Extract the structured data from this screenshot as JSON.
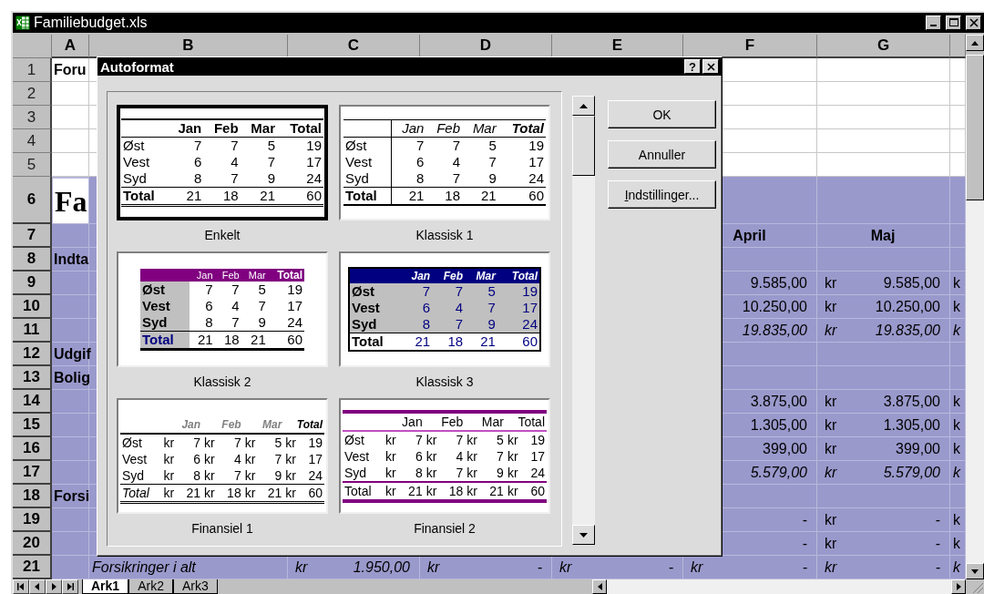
{
  "window": {
    "title": "Familiebudget.xls"
  },
  "columns": [
    "A",
    "B",
    "C",
    "D",
    "E",
    "F",
    "G"
  ],
  "rows": [
    {
      "number": "1",
      "selected": false,
      "cells": [
        {
          "kind": "heading",
          "text": "Foru"
        }
      ]
    },
    {
      "number": "2",
      "selected": false
    },
    {
      "number": "3",
      "selected": false
    },
    {
      "number": "4",
      "selected": false
    },
    {
      "number": "5",
      "selected": false
    },
    {
      "number": "6",
      "selected": true,
      "cells": [
        {
          "kind": "title",
          "text": "Fa"
        }
      ]
    },
    {
      "number": "7",
      "selected": true,
      "cells": [
        null,
        null,
        null,
        null,
        null,
        {
          "kind": "heading-center",
          "text": "April"
        },
        {
          "kind": "heading-center",
          "text": "Maj"
        }
      ]
    },
    {
      "number": "8",
      "selected": true,
      "cells": [
        {
          "kind": "heading",
          "text": "Indta"
        }
      ]
    },
    {
      "number": "9",
      "selected": true,
      "cells": [
        null,
        null,
        null,
        null,
        null,
        {
          "kind": "amount",
          "text": "9.585,00"
        },
        {
          "kind": "accounting",
          "currency": "kr",
          "amount": "9.585,00"
        },
        {
          "kind": "text",
          "text": "k"
        }
      ]
    },
    {
      "number": "10",
      "selected": true,
      "cells": [
        null,
        null,
        null,
        null,
        null,
        {
          "kind": "amount",
          "text": "10.250,00"
        },
        {
          "kind": "accounting",
          "currency": "kr",
          "amount": "10.250,00"
        },
        {
          "kind": "text",
          "text": "k"
        }
      ]
    },
    {
      "number": "11",
      "selected": true,
      "cells": [
        null,
        null,
        null,
        null,
        null,
        {
          "kind": "amount",
          "text": "19.835,00",
          "italic": true
        },
        {
          "kind": "accounting",
          "currency": "kr",
          "amount": "19.835,00",
          "italic": true
        },
        {
          "kind": "text",
          "text": "k",
          "italic": true
        }
      ]
    },
    {
      "number": "12",
      "selected": true,
      "cells": [
        {
          "kind": "heading",
          "text": "Udgif"
        }
      ]
    },
    {
      "number": "13",
      "selected": true,
      "cells": [
        {
          "kind": "heading",
          "text": "Bolig"
        }
      ]
    },
    {
      "number": "14",
      "selected": true,
      "cells": [
        null,
        null,
        null,
        null,
        null,
        {
          "kind": "amount",
          "text": "3.875,00"
        },
        {
          "kind": "accounting",
          "currency": "kr",
          "amount": "3.875,00"
        },
        {
          "kind": "text",
          "text": "k"
        }
      ]
    },
    {
      "number": "15",
      "selected": true,
      "cells": [
        null,
        null,
        null,
        null,
        null,
        {
          "kind": "amount",
          "text": "1.305,00"
        },
        {
          "kind": "accounting",
          "currency": "kr",
          "amount": "1.305,00"
        },
        {
          "kind": "text",
          "text": "k"
        }
      ]
    },
    {
      "number": "16",
      "selected": true,
      "cells": [
        null,
        null,
        null,
        null,
        null,
        {
          "kind": "amount",
          "text": "399,00"
        },
        {
          "kind": "accounting",
          "currency": "kr",
          "amount": "399,00"
        },
        {
          "kind": "text",
          "text": "k"
        }
      ]
    },
    {
      "number": "17",
      "selected": true,
      "cells": [
        null,
        null,
        null,
        null,
        null,
        {
          "kind": "amount",
          "text": "5.579,00",
          "italic": true
        },
        {
          "kind": "accounting",
          "currency": "kr",
          "amount": "5.579,00",
          "italic": true
        },
        {
          "kind": "text",
          "text": "k",
          "italic": true
        }
      ]
    },
    {
      "number": "18",
      "selected": true,
      "cells": [
        {
          "kind": "heading",
          "text": "Forsi"
        }
      ]
    },
    {
      "number": "19",
      "selected": true,
      "cells": [
        null,
        null,
        null,
        null,
        null,
        {
          "kind": "amount",
          "text": "-"
        },
        {
          "kind": "accounting",
          "currency": "kr",
          "amount": "-"
        },
        {
          "kind": "text",
          "text": "k"
        }
      ]
    },
    {
      "number": "20",
      "selected": true,
      "cells": [
        null,
        null,
        null,
        null,
        null,
        {
          "kind": "amount",
          "text": "-"
        },
        {
          "kind": "accounting",
          "currency": "kr",
          "amount": "-"
        },
        {
          "kind": "text",
          "text": "k"
        }
      ]
    },
    {
      "number": "21",
      "selected": true,
      "cells": [
        null,
        {
          "kind": "text",
          "text": "Forsikringer i alt",
          "italic": true
        },
        {
          "kind": "accounting",
          "currency": "kr",
          "amount": "1.950,00",
          "italic": true
        },
        {
          "kind": "accounting",
          "currency": "kr",
          "amount": "-",
          "italic": true
        },
        {
          "kind": "accounting",
          "currency": "kr",
          "amount": "-",
          "italic": true
        },
        {
          "kind": "accounting",
          "currency": "kr",
          "amount": "-",
          "italic": true
        },
        {
          "kind": "accounting",
          "currency": "kr",
          "amount": "-",
          "italic": true
        },
        {
          "kind": "text",
          "text": "k",
          "italic": true
        }
      ]
    }
  ],
  "sheet_tabs": [
    {
      "label": "Ark1",
      "selected": true
    },
    {
      "label": "Ark2",
      "selected": false
    },
    {
      "label": "Ark3",
      "selected": false
    }
  ],
  "dialog": {
    "title": "Autoformat",
    "help": "?",
    "formats": [
      {
        "name": "Enkelt",
        "kind": "enkelt",
        "selected": true,
        "header": [
          "Jan",
          "Feb",
          "Mar",
          "Total"
        ],
        "rows": [
          [
            "Øst",
            "7",
            "7",
            "5",
            "19"
          ],
          [
            "Vest",
            "6",
            "4",
            "7",
            "17"
          ],
          [
            "Syd",
            "8",
            "7",
            "9",
            "24"
          ]
        ],
        "total": [
          "Total",
          "21",
          "18",
          "21",
          "60"
        ]
      },
      {
        "name": "Klassisk 1",
        "kind": "klassisk1",
        "selected": false,
        "header": [
          "Jan",
          "Feb",
          "Mar",
          "Total"
        ],
        "rows": [
          [
            "Øst",
            "7",
            "7",
            "5",
            "19"
          ],
          [
            "Vest",
            "6",
            "4",
            "7",
            "17"
          ],
          [
            "Syd",
            "8",
            "7",
            "9",
            "24"
          ]
        ],
        "total": [
          "Total",
          "21",
          "18",
          "21",
          "60"
        ]
      },
      {
        "name": "Klassisk 2",
        "kind": "klassisk2",
        "selected": false,
        "header": [
          "Jan",
          "Feb",
          "Mar",
          "Total"
        ],
        "rows": [
          [
            "Øst",
            "7",
            "7",
            "5",
            "19"
          ],
          [
            "Vest",
            "6",
            "4",
            "7",
            "17"
          ],
          [
            "Syd",
            "8",
            "7",
            "9",
            "24"
          ]
        ],
        "total": [
          "Total",
          "21",
          "18",
          "21",
          "60"
        ]
      },
      {
        "name": "Klassisk 3",
        "kind": "klassisk3",
        "selected": false,
        "header": [
          "Jan",
          "Feb",
          "Mar",
          "Total"
        ],
        "rows": [
          [
            "Øst",
            "7",
            "7",
            "5",
            "19"
          ],
          [
            "Vest",
            "6",
            "4",
            "7",
            "17"
          ],
          [
            "Syd",
            "8",
            "7",
            "9",
            "24"
          ]
        ],
        "total": [
          "Total",
          "21",
          "18",
          "21",
          "60"
        ]
      },
      {
        "name": "Finansiel 1",
        "kind": "finansiel1",
        "selected": false,
        "header": [
          "Jan",
          "Feb",
          "Mar",
          "Total"
        ],
        "rows": [
          [
            "Øst",
            "kr",
            "7",
            "kr",
            "7",
            "kr",
            "5",
            "kr",
            "19"
          ],
          [
            "Vest",
            "kr",
            "6",
            "kr",
            "4",
            "kr",
            "7",
            "kr",
            "17"
          ],
          [
            "Syd",
            "kr",
            "8",
            "kr",
            "7",
            "kr",
            "9",
            "kr",
            "24"
          ]
        ],
        "total": [
          "Total",
          "kr",
          "21",
          "kr",
          "18",
          "kr",
          "21",
          "kr",
          "60"
        ]
      },
      {
        "name": "Finansiel 2",
        "kind": "finansiel2",
        "selected": false,
        "header": [
          "Jan",
          "Feb",
          "Mar",
          "Total"
        ],
        "rows": [
          [
            "Øst",
            "kr",
            "7",
            "kr",
            "7",
            "kr",
            "5",
            "kr",
            "19"
          ],
          [
            "Vest",
            "kr",
            "6",
            "kr",
            "4",
            "kr",
            "7",
            "kr",
            "17"
          ],
          [
            "Syd",
            "kr",
            "8",
            "kr",
            "7",
            "kr",
            "9",
            "kr",
            "24"
          ]
        ],
        "total": [
          "Total",
          "kr",
          "21",
          "kr",
          "18",
          "kr",
          "21",
          "kr",
          "60"
        ]
      }
    ],
    "buttons": [
      {
        "label": "OK",
        "mnemonic": false
      },
      {
        "label": "Annuller",
        "mnemonic": false
      },
      {
        "label": "Indstillinger...",
        "mnemonic": true
      }
    ]
  }
}
